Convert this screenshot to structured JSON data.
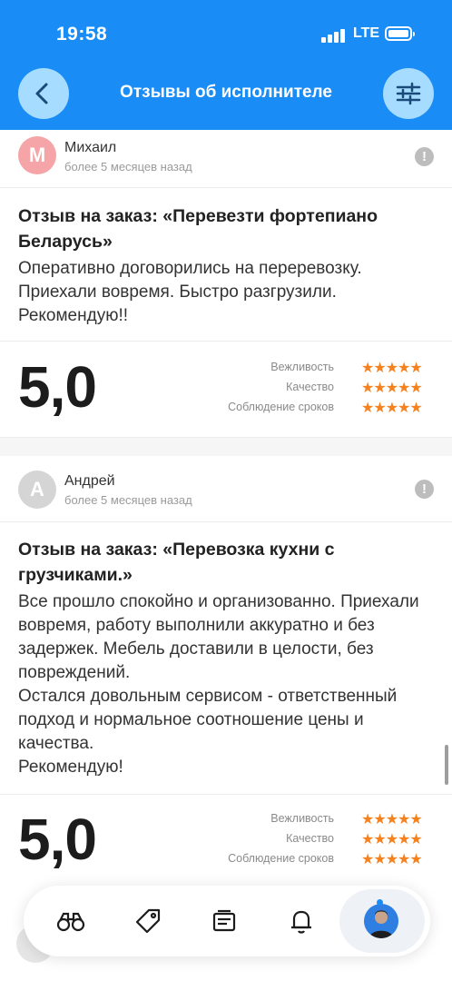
{
  "status_bar": {
    "time": "19:58",
    "network": "LTE"
  },
  "header": {
    "title": "Отзывы об исполнителе"
  },
  "reviews": [
    {
      "avatar_letter": "М",
      "avatar_color": "#f5a5a8",
      "author": "Михаил",
      "date": "более 5 месяцев назад",
      "title": "Отзыв на заказ: «Перевезти фортепиано Беларусь»",
      "text": "Оперативно договорились на переревозку. Приехали вовремя. Быстро разгрузили. Рекомендую!!",
      "score": "5,0",
      "criteria": [
        {
          "label": "Вежливость",
          "stars": "★★★★★",
          "rating": 5
        },
        {
          "label": "Качество",
          "stars": "★★★★★",
          "rating": 5
        },
        {
          "label": "Соблюдение сроков",
          "stars": "★★★★★",
          "rating": 5
        }
      ]
    },
    {
      "avatar_letter": "А",
      "avatar_color": "#d5d5d5",
      "author": "Андрей",
      "date": "более 5 месяцев назад",
      "title": "Отзыв на заказ: «Перевозка кухни с грузчиками.»",
      "text": "Все прошло спокойно и организованно. Приехали вовремя, работу выполнили аккуратно и без задержек. Мебель доставили в целости, без повреждений.\nОстался довольным сервисом - ответственный подход и нормальное соотношение цены и качества.\nРекомендую!",
      "score": "5,0",
      "criteria": [
        {
          "label": "Вежливость",
          "stars": "★★★★★",
          "rating": 5
        },
        {
          "label": "Качество",
          "stars": "★★★★★",
          "rating": 5
        },
        {
          "label": "Соблюдение сроков",
          "stars": "★★★★★",
          "rating": 5
        }
      ]
    }
  ],
  "tab_bar": {
    "items": [
      "binoculars-icon",
      "tag-icon",
      "document-icon",
      "bell-icon",
      "profile-avatar"
    ],
    "active": "profile-avatar"
  },
  "colors": {
    "accent": "#1a8cf5",
    "star": "#f5821f"
  }
}
